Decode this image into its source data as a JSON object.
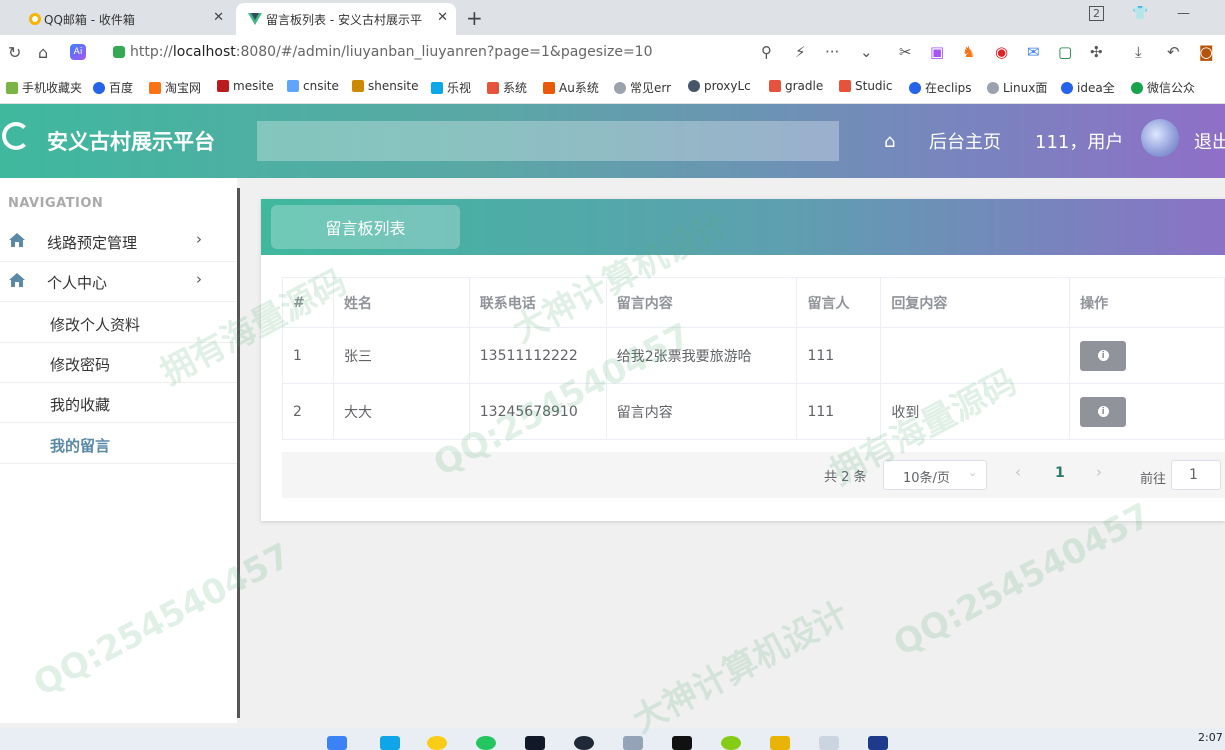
{
  "browser": {
    "tabs": [
      {
        "label": "QQ邮箱 - 收件箱",
        "active": false
      },
      {
        "label": "留言板列表 - 安义古村展示平",
        "active": true
      }
    ],
    "tab_count_badge": "2",
    "url_prefix": "http://",
    "url_host": "localhost",
    "url_rest": ":8080/#/admin/liuyanban_liuyanren?page=1&pagesize=10",
    "ai_badge": "Ai",
    "bookmarks": [
      "手机收藏夹",
      "百度",
      "淘宝网",
      "mesite",
      "cnsite",
      "shensite",
      "乐视",
      "系统",
      "Au系统",
      "常见err",
      "proxyLc",
      "gradle",
      "Studic",
      "在eclips",
      "Linux面",
      "idea全",
      "微信公众"
    ]
  },
  "header": {
    "app_name": "安义古村展示平台",
    "nav_home": "后台主页",
    "user_greeting": "111，用户",
    "logout": "退出"
  },
  "sidebar": {
    "title": "NAVIGATION",
    "menus": [
      {
        "label": "线路预定管理"
      },
      {
        "label": "个人中心"
      }
    ],
    "sub_items": [
      {
        "label": "修改个人资料"
      },
      {
        "label": "修改密码"
      },
      {
        "label": "我的收藏"
      },
      {
        "label": "我的留言"
      }
    ]
  },
  "main": {
    "tab_label": "留言板列表",
    "columns": [
      "#",
      "姓名",
      "联系电话",
      "留言内容",
      "留言人",
      "回复内容",
      "操作"
    ],
    "rows": [
      [
        "1",
        "张三",
        "13511112222",
        "给我2张票我要旅游哈",
        "111",
        ""
      ],
      [
        "2",
        "大大",
        "13245678910",
        "留言内容",
        "111",
        "收到"
      ]
    ],
    "pagination": {
      "total": "共 2 条",
      "page_size": "10条/页",
      "current_page": "1",
      "goto_label": "前往",
      "goto_value": "1"
    }
  },
  "taskbar": {
    "time": "2:07"
  },
  "watermark": [
    "拥有海量源码",
    "QQ:254540457",
    "大神计算机设计"
  ],
  "colors": {
    "accent_start": "#3fb89e",
    "accent_end": "#8f6fc7",
    "active_menu": "#5b8aa6"
  }
}
